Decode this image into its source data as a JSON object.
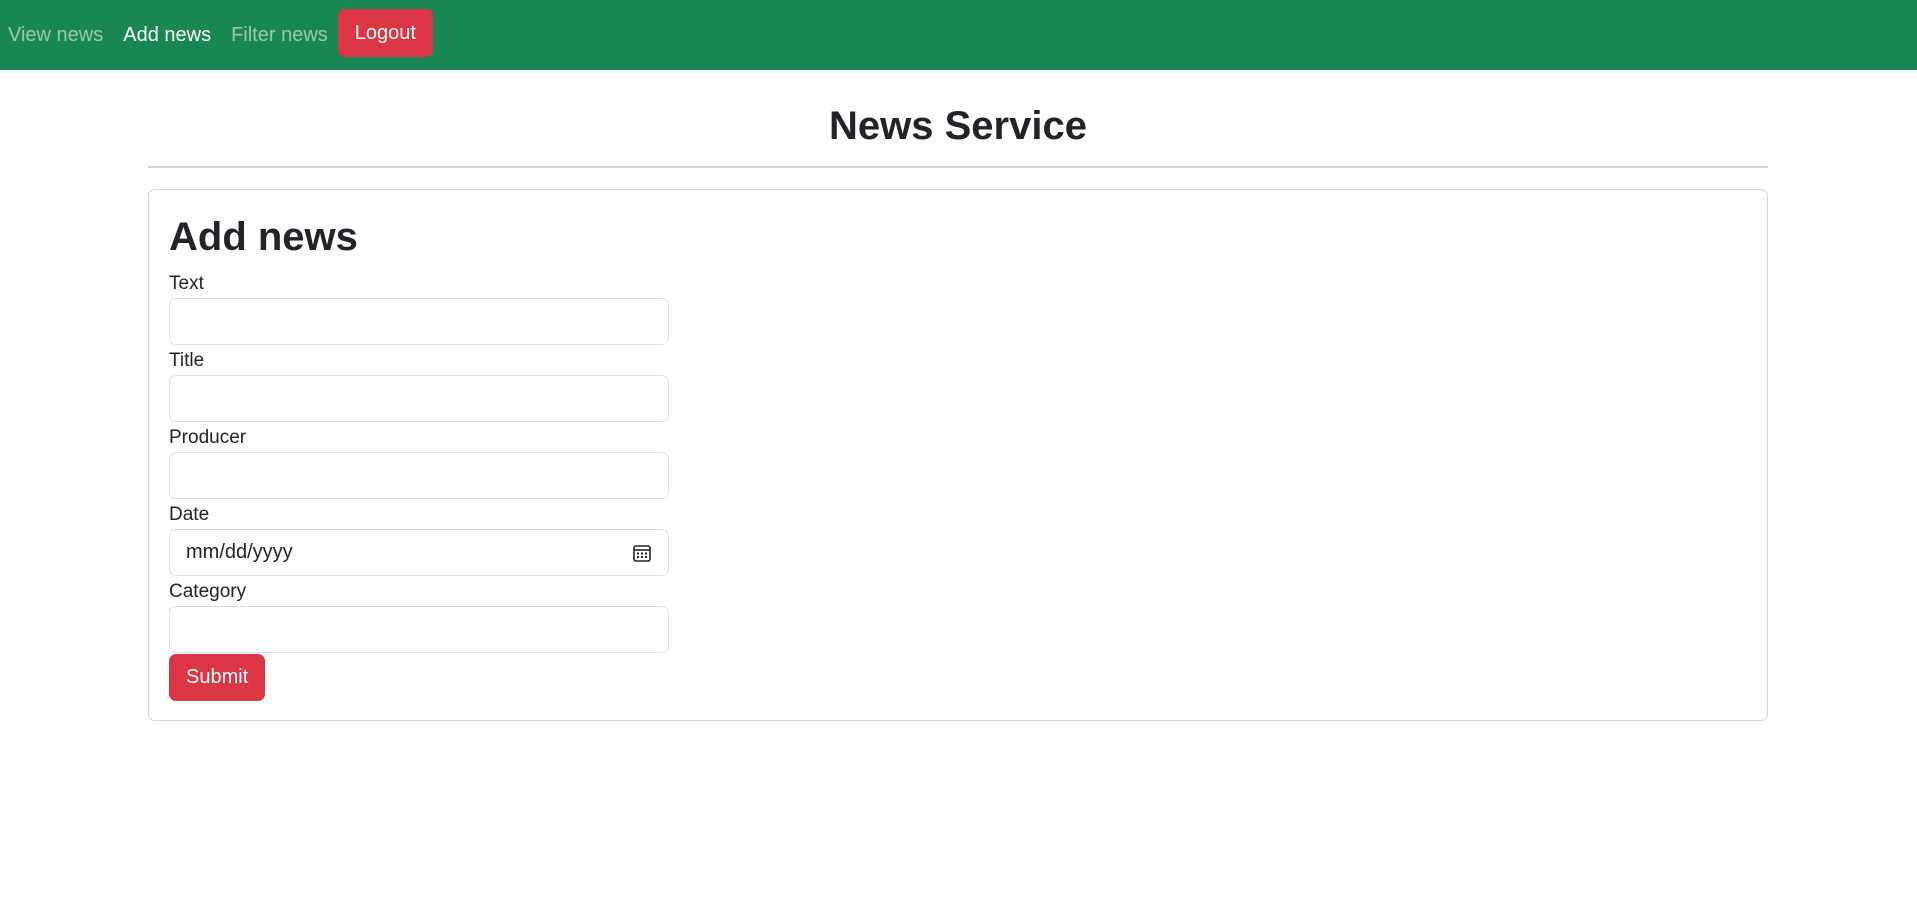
{
  "nav": {
    "view_news": "View news",
    "add_news": "Add news",
    "filter_news": "Filter news",
    "logout": "Logout"
  },
  "page": {
    "title": "News Service"
  },
  "form": {
    "title": "Add news",
    "text_label": "Text",
    "text_value": "",
    "title_label": "Title",
    "title_value": "",
    "producer_label": "Producer",
    "producer_value": "",
    "date_label": "Date",
    "date_placeholder": "mm/dd/yyyy",
    "category_label": "Category",
    "category_value": "",
    "submit_label": "Submit"
  },
  "icons": {
    "date_picker": "calendar-icon"
  },
  "colors": {
    "navbar": "#198754",
    "danger": "#dc3545",
    "text": "#212529"
  }
}
